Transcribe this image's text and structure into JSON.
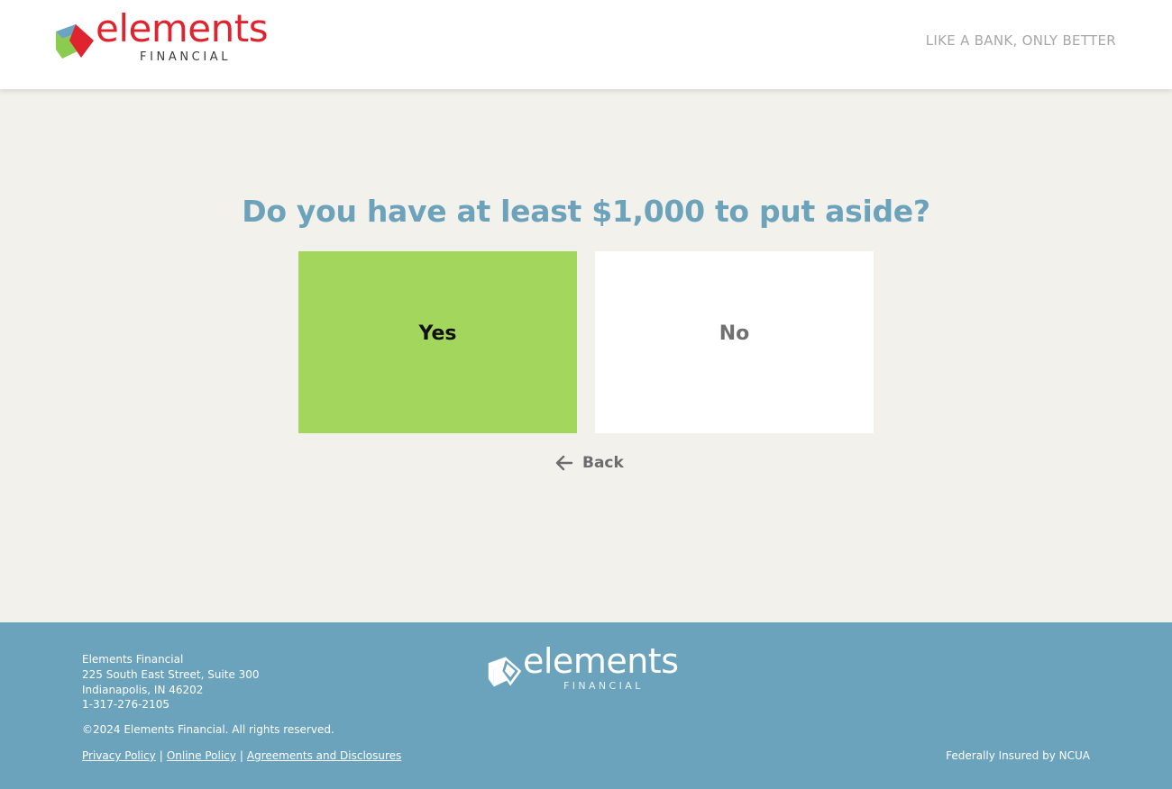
{
  "header": {
    "logo_word": "elements",
    "logo_sub": "FINANCIAL",
    "tagline": "LIKE A BANK, ONLY BETTER"
  },
  "question": {
    "text": "Do you have at least $1,000 to put aside?",
    "options": [
      {
        "label": "Yes",
        "selected": true
      },
      {
        "label": "No",
        "selected": false
      }
    ],
    "back_label": "Back"
  },
  "footer": {
    "address_lines": [
      "Elements Financial",
      "225 South East Street, Suite 300",
      "Indianapolis, IN 46202",
      "1-317-276-2105"
    ],
    "copyright": "©2024 Elements Financial. All rights reserved.",
    "links": [
      "Privacy Policy",
      "Online Policy",
      "Agreements and Disclosures"
    ],
    "separator": "|",
    "insured": "Federally Insured by NCUA",
    "logo_word": "elements",
    "logo_sub": "FINANCIAL"
  },
  "colors": {
    "brand_red": "#e0242f",
    "brand_blue": "#6aa3bb",
    "brand_green": "#a3d65d",
    "page_bg": "#f2f1ec"
  },
  "icons": {
    "logo": "elements-cube-logo-icon",
    "back": "arrow-left-icon"
  }
}
